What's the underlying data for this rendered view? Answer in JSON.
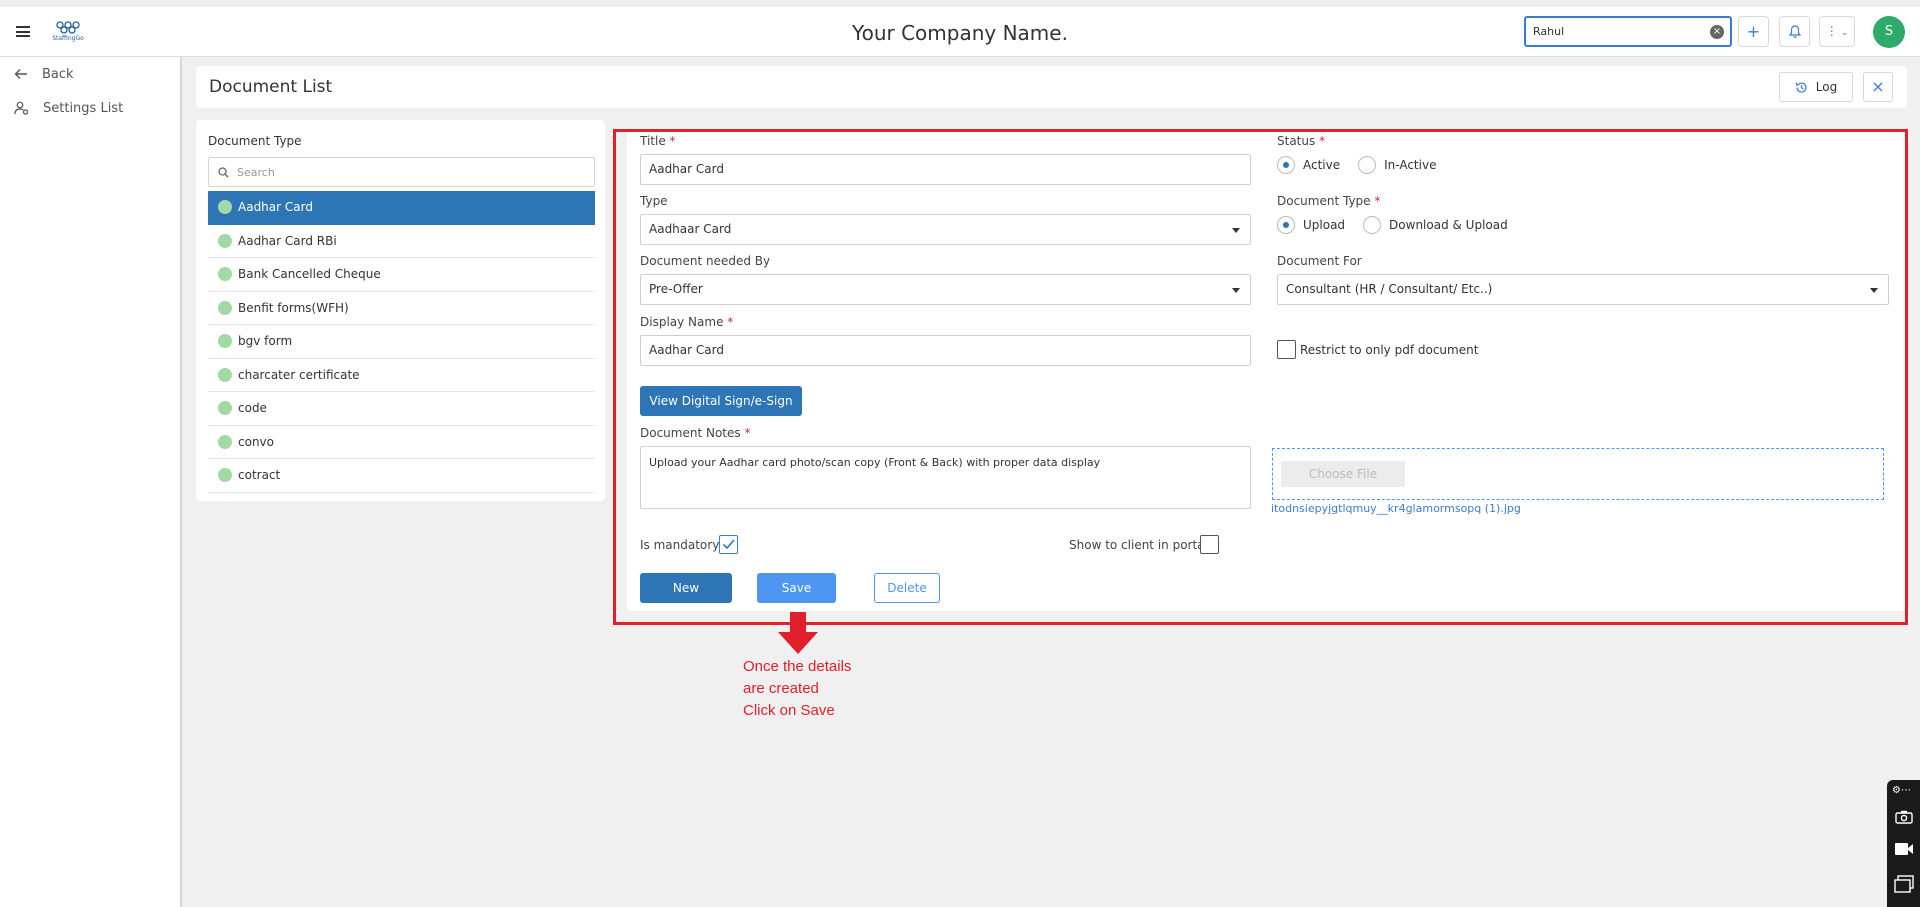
{
  "topbar": {
    "logo_text": "StaffingGo",
    "company_name": "Your Company Name.",
    "search_value": "Rahul",
    "add_icon": "plus-icon",
    "notification_icon": "bell-icon",
    "more_icon": "more-vertical-icon",
    "avatar_initial": "S",
    "avatar_color": "#2eaa6a"
  },
  "leftnav": {
    "items": [
      {
        "label": "Back",
        "icon": "arrow-left-icon"
      },
      {
        "label": "Settings List",
        "icon": "user-settings-icon"
      }
    ]
  },
  "header": {
    "title": "Document List",
    "log_label": "Log",
    "close_icon": "close-icon"
  },
  "doc_panel": {
    "title": "Document Type",
    "search_placeholder": "Search",
    "items": [
      "Aadhar Card",
      "Aadhar Card RBi",
      "Bank Cancelled Cheque",
      "Benfit forms(WFH)",
      "bgv form",
      "charcater certificate",
      "code",
      "convo",
      "cotract"
    ],
    "selected_index": 0,
    "accent_color": "#2e75b6"
  },
  "form": {
    "title_label": "Title",
    "title_value": "Aadhar Card",
    "status_label": "Status",
    "status_options": [
      "Active",
      "In-Active"
    ],
    "status_selected": "Active",
    "type_label": "Type",
    "type_value": "Aadhaar Card",
    "doc_type_label": "Document Type",
    "doc_type_options": [
      "Upload",
      "Download & Upload"
    ],
    "doc_type_selected": "Upload",
    "needed_by_label": "Document needed By",
    "needed_by_value": "Pre-Offer",
    "doc_for_label": "Document For",
    "doc_for_value": "Consultant (HR / Consultant/ Etc..)",
    "display_name_label": "Display Name",
    "display_name_value": "Aadhar Card",
    "restrict_label": "Restrict to only pdf document",
    "restrict_checked": false,
    "view_sign_label": "View Digital Sign/e-Sign",
    "notes_label": "Document Notes",
    "notes_value": "Upload your Aadhar card photo/scan copy (Front & Back) with proper data display",
    "choose_file_label": "Choose File",
    "file_name": "itodnsiepyjgtlqmuy__kr4glamormsopq (1).jpg",
    "mandatory_label": "Is mandatory",
    "mandatory_checked": true,
    "show_client_label": "Show to client in portal",
    "show_client_checked": false,
    "new_label": "New",
    "save_label": "Save",
    "delete_label": "Delete",
    "required_mark": "*"
  },
  "annotation": {
    "lines": [
      "Once the details",
      "are created",
      "Click on Save"
    ],
    "color": "#e0202a"
  }
}
